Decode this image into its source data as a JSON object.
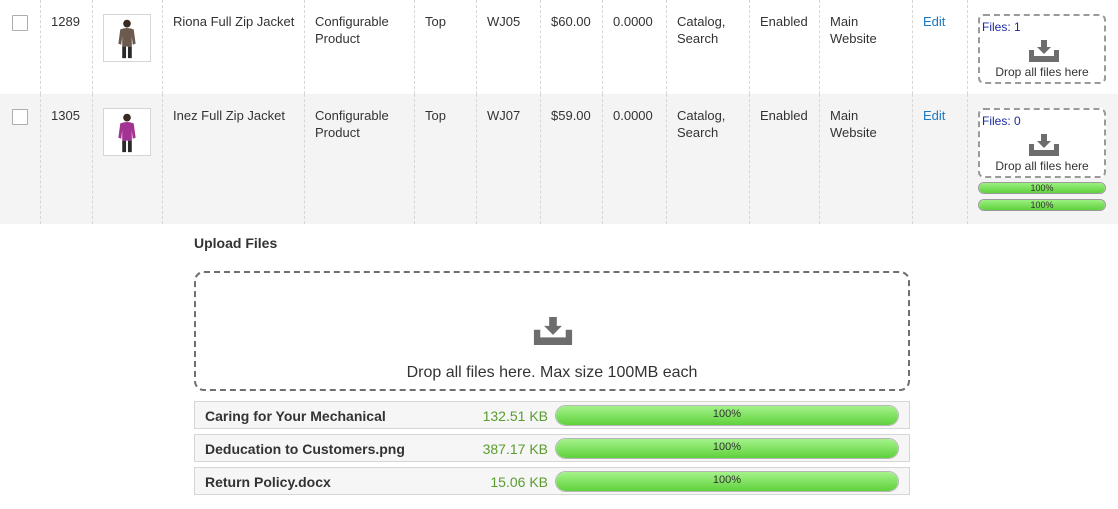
{
  "products": [
    {
      "id": "1289",
      "name": "Riona Full Zip Jacket",
      "type": "Configurable Product",
      "attribute_set": "Top",
      "sku": "WJ05",
      "price": "$60.00",
      "quantity": "0.0000",
      "visibility": "Catalog, Search",
      "status": "Enabled",
      "websites": "Main Website",
      "action": "Edit",
      "files_count": "Files: 1",
      "drop_text": "Drop all files here",
      "progress": [],
      "thumb_color": "#6b5a4e"
    },
    {
      "id": "1305",
      "name": "Inez Full Zip Jacket",
      "type": "Configurable Product",
      "attribute_set": "Top",
      "sku": "WJ07",
      "price": "$59.00",
      "quantity": "0.0000",
      "visibility": "Catalog, Search",
      "status": "Enabled",
      "websites": "Main Website",
      "action": "Edit",
      "files_count": "Files: 0",
      "drop_text": "Drop all files here",
      "progress": [
        {
          "label": "100%",
          "value": 1.0
        },
        {
          "label": "100%",
          "value": 1.0
        }
      ],
      "thumb_color": "#a23393"
    }
  ],
  "upload": {
    "title": "Upload Files",
    "drop_text": "Drop all files here. Max size 100MB each",
    "files": [
      {
        "name": "Caring for Your Mechanical",
        "size": "132.51 KB",
        "progress_label": "100%",
        "progress": 1.0
      },
      {
        "name": "Deducation to Customers.png",
        "size": "387.17 KB",
        "progress_label": "100%",
        "progress": 1.0
      },
      {
        "name": "Return Policy.docx",
        "size": "15.06 KB",
        "progress_label": "100%",
        "progress": 1.0
      }
    ]
  },
  "colors": {
    "link": "#1979c3",
    "size_text": "#5a9c2f",
    "progress_fill": "#5fd13c",
    "files_count": "#1a2aa4"
  },
  "icons": {
    "download_tray": "download-tray-icon"
  }
}
